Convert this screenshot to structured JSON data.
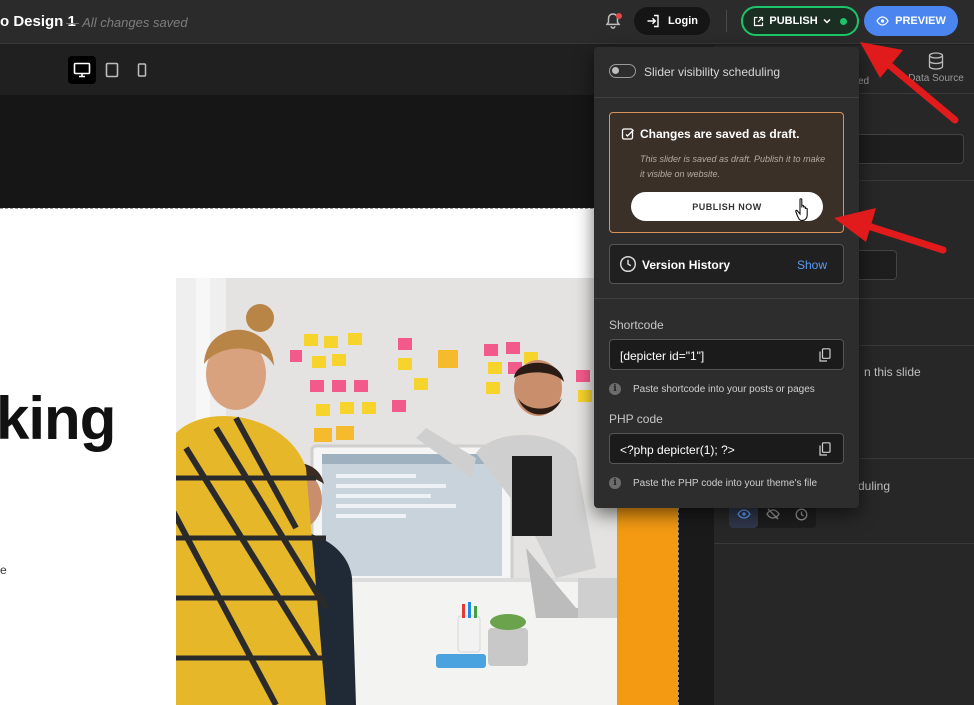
{
  "header": {
    "title": "o Design 1",
    "saved_status": "— All changes saved",
    "login_label": "Login",
    "publish_label": "PUBLISH",
    "preview_label": "PREVIEW"
  },
  "device_bar": {
    "devices": [
      "desktop-icon",
      "tablet-icon",
      "mobile-icon"
    ],
    "active": "desktop"
  },
  "canvas": {
    "heading_fragment": "king",
    "small_text": "e"
  },
  "right_panel": {
    "partial_label_1": "ed",
    "data_source_label": "Data Source",
    "partial_text_1": "n this slide",
    "partial_text_2": "duling"
  },
  "publish_dropdown": {
    "scheduling_label": "Slider visibility scheduling",
    "draft": {
      "title": "Changes are saved as draft.",
      "description": "This slider is saved as draft. Publish it to make it visible on website.",
      "publish_now_label": "PUBLISH NOW"
    },
    "version_history": {
      "label": "Version History",
      "show_label": "Show"
    },
    "shortcode": {
      "label": "Shortcode",
      "value": "[depicter id=\"1\"]",
      "hint": "Paste shortcode into your posts or pages"
    },
    "php_code": {
      "label": "PHP code",
      "value": "<?php depicter(1); ?>",
      "hint": "Paste the PHP code into your theme's file"
    }
  },
  "colors": {
    "publish_green": "#1ec46a",
    "preview_blue": "#4b86f0",
    "draft_border": "#d8925a",
    "link_blue": "#5a9cf2",
    "annotation_red": "#e11b1b",
    "accent_orange": "#f39a12"
  }
}
